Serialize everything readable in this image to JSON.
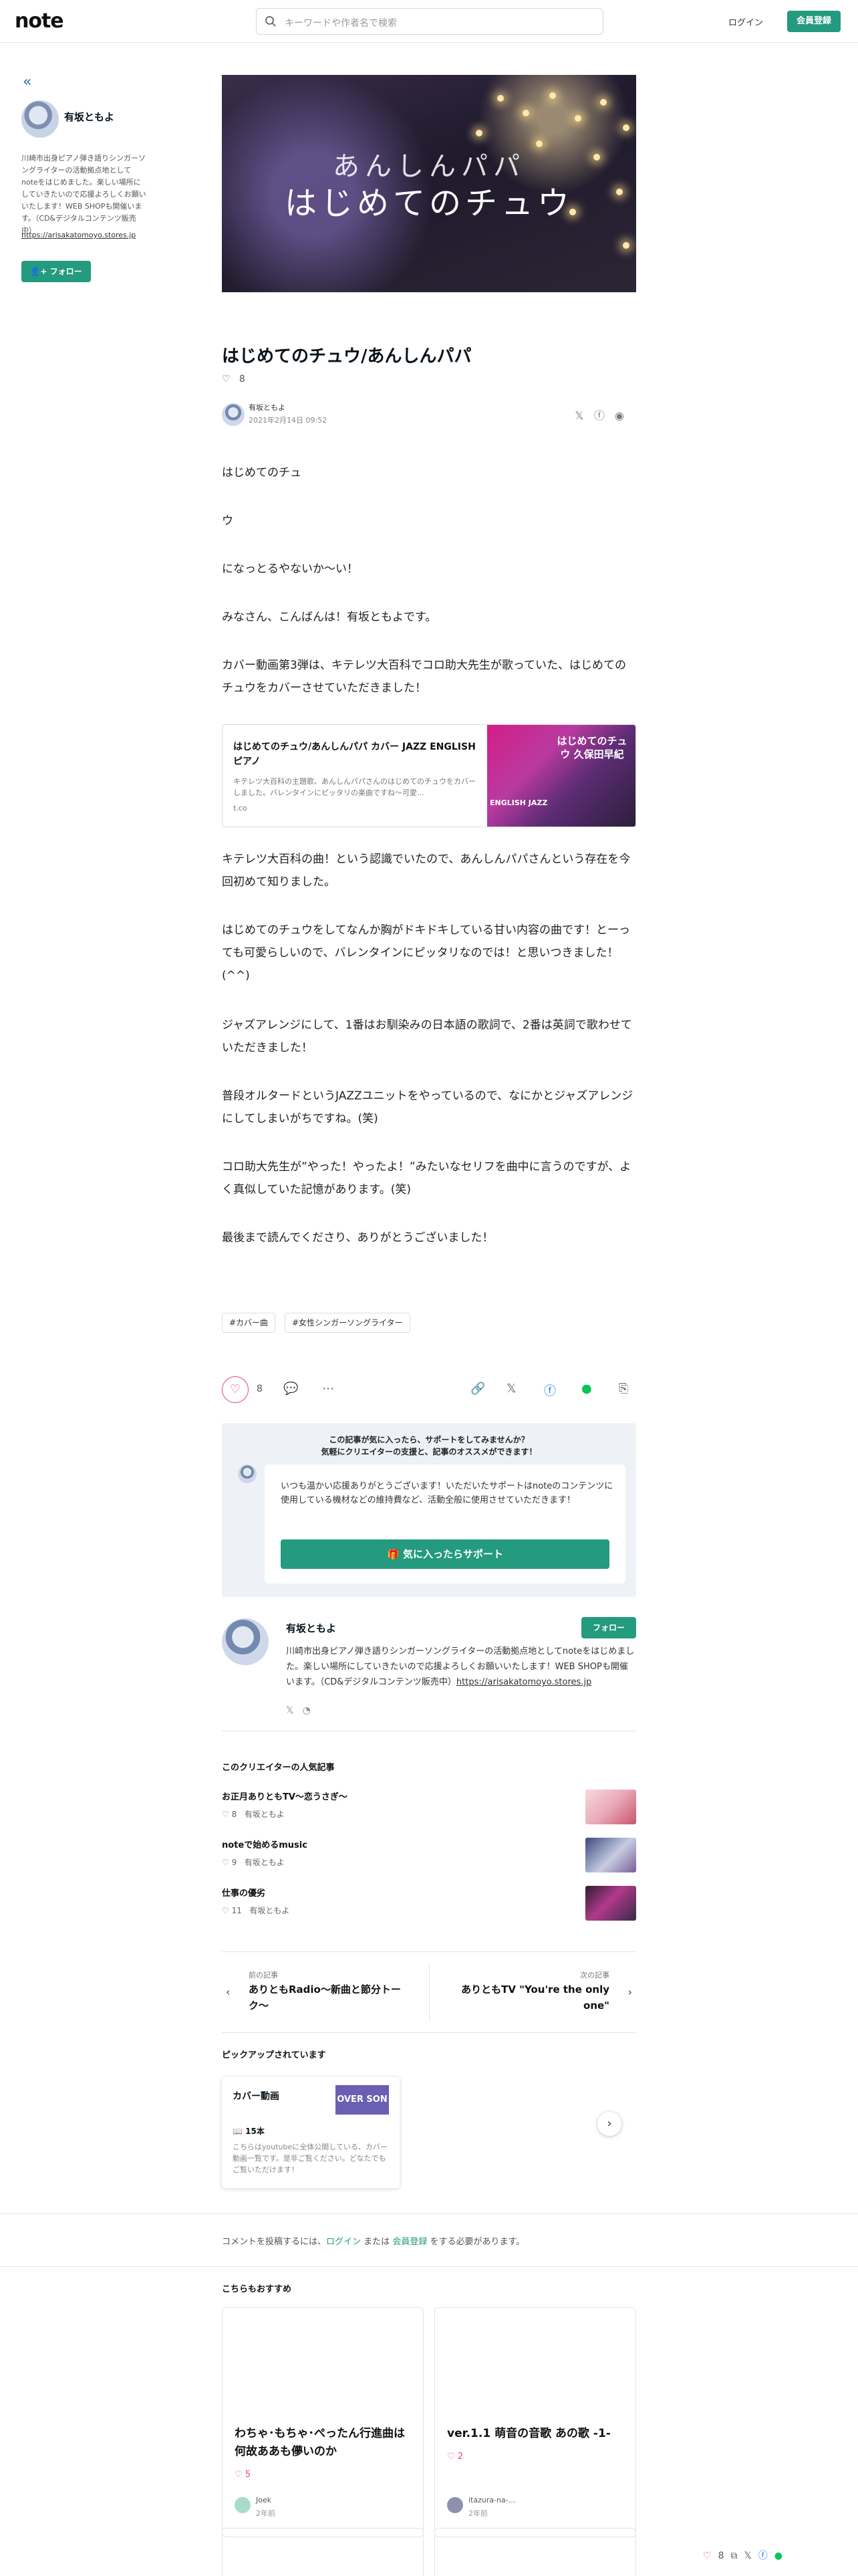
{
  "header": {
    "logo": "note",
    "search_placeholder": "キーワードや作者名で検索",
    "login_label": "ログイン",
    "signup_label": "会員登録"
  },
  "sidebar": {
    "author_name": "有坂ともよ",
    "bio": "川崎市出身ピアノ弾き語りシンガーソングライターの活動拠点地としてnoteをはじめました。楽しい場所にしていきたいので応援よろしくお願いいたします！WEB SHOPも開催います。（CD&デジタルコンテンツ販売中）",
    "link": "https://arisakatomoyo.stores.jp",
    "follow_label": "フォロー"
  },
  "hero": {
    "line1": "あんしんパパ",
    "line2": "はじめてのチュウ"
  },
  "article": {
    "title": "はじめてのチュウ/あんしんパパ",
    "like_count": "8",
    "author_name": "有坂ともよ",
    "date": "2021年2月14日 09:52",
    "paragraphs": [
      "はじめてのチュ",
      "ウ",
      "になっとるやないか〜い！",
      "みなさん、こんばんは！有坂ともよです。",
      "カバー動画第3弾は、キテレツ大百科でコロ助大先生が歌っていた、はじめてのチュウをカバーさせていただきました！",
      "キテレツ大百科の曲！という認識でいたので、あんしんパパさんという存在を今回初めて知りました。",
      "はじめてのチュウをしてなんか胸がドキドキしている甘い内容の曲です！とーっても可愛らしいので、バレンタインにピッタリなのでは！と思いつきました！(^^)",
      "ジャズアレンジにして、1番はお馴染みの日本語の歌詞で、2番は英詞で歌わせていただきました！",
      "普段オルタードというJAZZユニットをやっているので、なにかとジャズアレンジにしてしまいがちですね。(笑)",
      "コロ助大先生が”やった！やったよ！”みたいなセリフを曲中に言うのですが、よく真似していた記憶があります。(笑)",
      "最後まで読んでくださり、ありがとうございました！"
    ],
    "embed": {
      "title": "はじめてのチュウ/あんしんパパ カバー JAZZ ENGLISH ピアノ",
      "desc": "キテレツ大百科の主題歌、あんしんパパさんのはじめてのチュウをカバーしました。バレンタインにピッタリの楽曲ですね〜可愛...",
      "host": "t.co",
      "thumb_title": "はじめてのチュウ 久保田早紀",
      "thumb_badge": "ENGLISH JAZZ"
    },
    "tags": [
      "#カバー曲",
      "#女性シンガーソングライター"
    ]
  },
  "actions": {
    "like_count": "8"
  },
  "support": {
    "heading_line1": "この記事が気に入ったら、サポートをしてみませんか？",
    "heading_line2": "気軽にクリエイターの支援と、記事のオススメができます！",
    "message": "いつも温かい応援ありがとうございます！いただいたサポートはnoteのコンテンツに使用している機材などの維持費など、活動全般に使用させていただきます！",
    "button_label": "気に入ったらサポート"
  },
  "creator": {
    "name": "有坂ともよ",
    "follow_label": "フォロー",
    "bio": "川崎市出身ピアノ弾き語りシンガーソングライターの活動拠点地としてnoteをはじめました。楽しい場所にしていきたいので応援よろしくお願いいたします！WEB SHOPも開催います。（CD&デジタルコンテンツ販売中）",
    "link": "https://arisakatomoyo.stores.jp"
  },
  "popular": {
    "title": "このクリエイターの人気記事",
    "items": [
      {
        "title": "お正月ありともTV〜恋うさぎ〜",
        "likes": "8",
        "author": "有坂ともよ"
      },
      {
        "title": "noteで始めるmusic",
        "likes": "9",
        "author": "有坂ともよ"
      },
      {
        "title": "仕事の優劣",
        "likes": "11",
        "author": "有坂ともよ"
      }
    ]
  },
  "prevnext": {
    "prev_label": "前の記事",
    "prev_title": "ありともRadio〜新曲と節分トーク〜",
    "next_label": "次の記事",
    "next_title": "ありともTV \"You're the only one\""
  },
  "pickup": {
    "section_title": "ピックアップされています",
    "card_title": "カバー動画",
    "thumb_text": "OVER SON",
    "count": "15本",
    "desc": "こちらはyoutubeに全体公開している、カバー動画一覧です。是非ご覧ください。どなたでもご覧いただけます！"
  },
  "comment": {
    "prefix": "コメントを投稿するには、",
    "login": "ログイン",
    "or": "または",
    "signup": "会員登録",
    "suffix": "をする必要があります。"
  },
  "recommend": {
    "section_title": "こちらもおすすめ",
    "items": [
      {
        "title": "わちゃ･もちゃ･ぺったん行進曲は何故ああも儚いのか",
        "likes": "5",
        "author": "Joek",
        "time": "2年前"
      },
      {
        "title": "ver.1.1 萌音の音歌 あの歌 -1-",
        "likes": "2",
        "author": "itazura-na-...",
        "time": "2年前"
      }
    ]
  },
  "sticky": {
    "like_count": "8"
  },
  "colors": {
    "accent": "#249a7e",
    "like": "#e24a6b"
  }
}
